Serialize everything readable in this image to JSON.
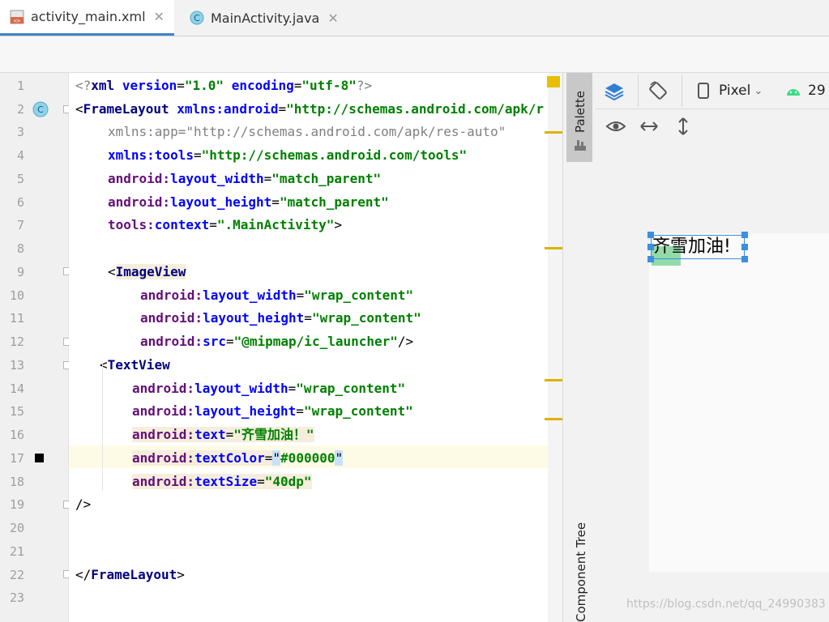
{
  "tabs": [
    {
      "label": "activity_main.xml",
      "icon": "xml-file-icon",
      "active": true
    },
    {
      "label": "MainActivity.java",
      "icon": "java-class-icon",
      "active": false
    }
  ],
  "editor": {
    "line_numbers": [
      "1",
      "2",
      "3",
      "4",
      "5",
      "6",
      "7",
      "8",
      "9",
      "10",
      "11",
      "12",
      "13",
      "14",
      "15",
      "16",
      "17",
      "18",
      "19",
      "20",
      "21",
      "22",
      "23"
    ],
    "current_line": "17"
  },
  "side_panel": {
    "palette_label": "Palette",
    "component_tree_label": "Component Tree"
  },
  "design_toolbar": {
    "device": "Pixel",
    "api_level": "29"
  },
  "preview": {
    "text": "齐雪加油!"
  },
  "watermark": "https://blog.csdn.net/qq_24990383",
  "colors": {
    "accent": "#4083c9",
    "selection": "#3d8ee0",
    "warning_mark": "#dcb300",
    "android_green": "#3ddc84"
  }
}
